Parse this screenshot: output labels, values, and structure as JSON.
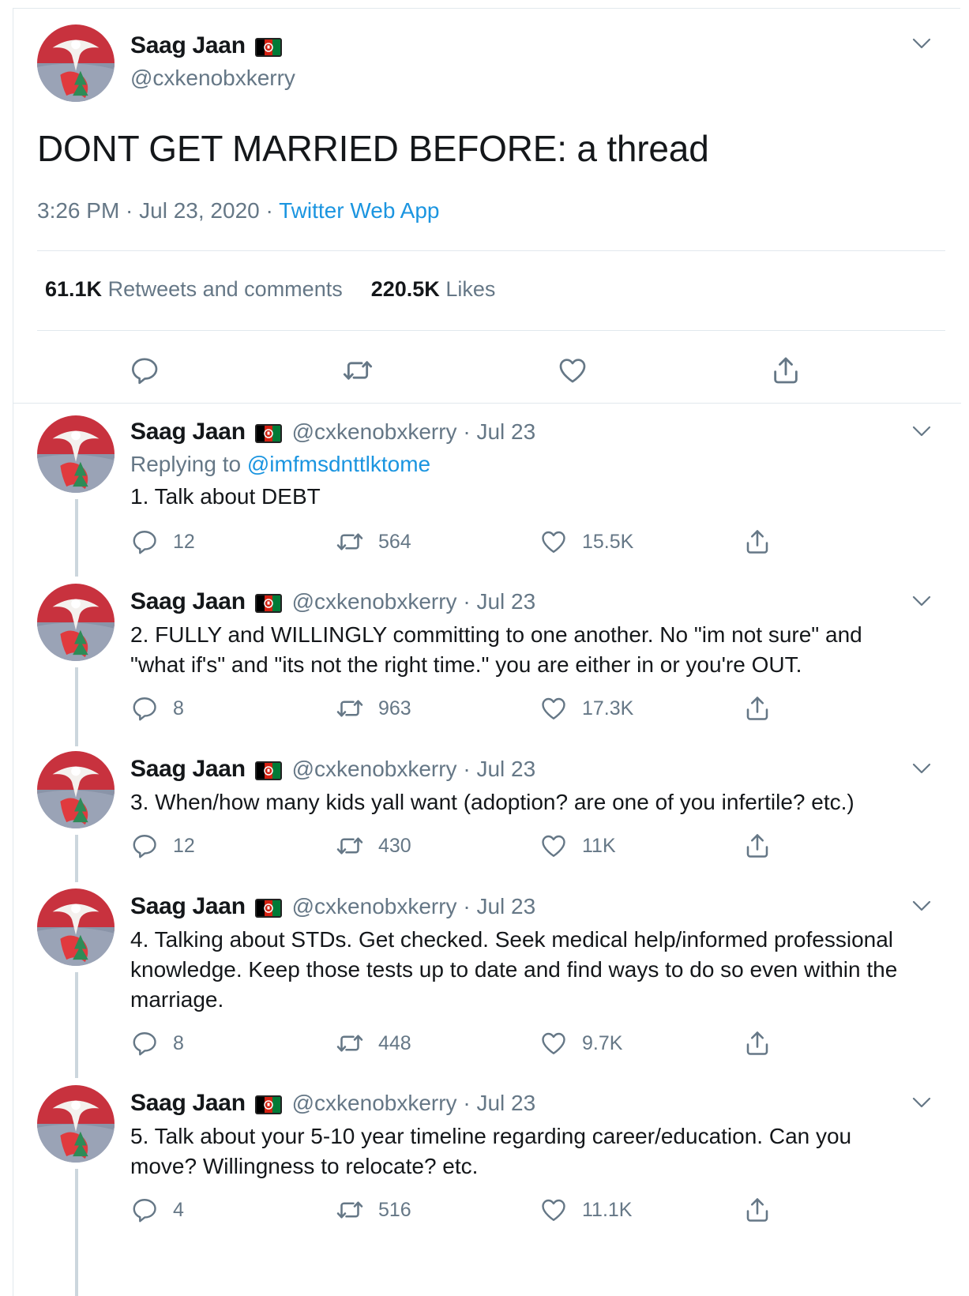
{
  "main": {
    "name": "Saag Jaan",
    "handle": "@cxkenobxkerry",
    "text": "DONT GET MARRIED BEFORE: a thread",
    "time": "3:26 PM · Jul 23, 2020 · ",
    "source": "Twitter Web App",
    "retweets_count": "61.1K",
    "retweets_label": "Retweets and comments",
    "likes_count": "220.5K",
    "likes_label": "Likes"
  },
  "replies": [
    {
      "name": "Saag Jaan",
      "meta": "@cxkenobxkerry · Jul 23",
      "replying_prefix": "Replying to ",
      "replying_to": "@imfmsdnttlktome",
      "text": "1. Talk about DEBT",
      "replies": "12",
      "retweets": "564",
      "likes": "15.5K"
    },
    {
      "name": "Saag Jaan",
      "meta": "@cxkenobxkerry · Jul 23",
      "text": "2. FULLY and WILLINGLY committing to one another. No \"im not sure\" and \"what if's\" and \"its not the right time.\" you are either in or you're OUT.",
      "replies": "8",
      "retweets": "963",
      "likes": "17.3K"
    },
    {
      "name": "Saag Jaan",
      "meta": "@cxkenobxkerry · Jul 23",
      "text": "3. When/how many kids yall want (adoption? are one of you infertile? etc.)",
      "replies": "12",
      "retweets": "430",
      "likes": "11K"
    },
    {
      "name": "Saag Jaan",
      "meta": "@cxkenobxkerry · Jul 23",
      "text": "4. Talking about STDs. Get checked. Seek medical help/informed professional knowledge. Keep those tests up to date and find ways to do so even within the marriage.",
      "replies": "8",
      "retweets": "448",
      "likes": "9.7K"
    },
    {
      "name": "Saag Jaan",
      "meta": "@cxkenobxkerry · Jul 23",
      "text": "5. Talk about your 5-10 year timeline regarding career/education. Can you move? Willingness to relocate? etc.",
      "replies": "4",
      "retweets": "516",
      "likes": "11.1K"
    }
  ],
  "colors": {
    "link": "#1b95e0",
    "muted": "#657786",
    "divider": "#e1e8ed",
    "thread_line": "#ccd6dd"
  },
  "icons": [
    "reply-icon",
    "retweet-icon",
    "like-icon",
    "share-icon",
    "chevron-down-icon",
    "afghan-flag-icon"
  ]
}
